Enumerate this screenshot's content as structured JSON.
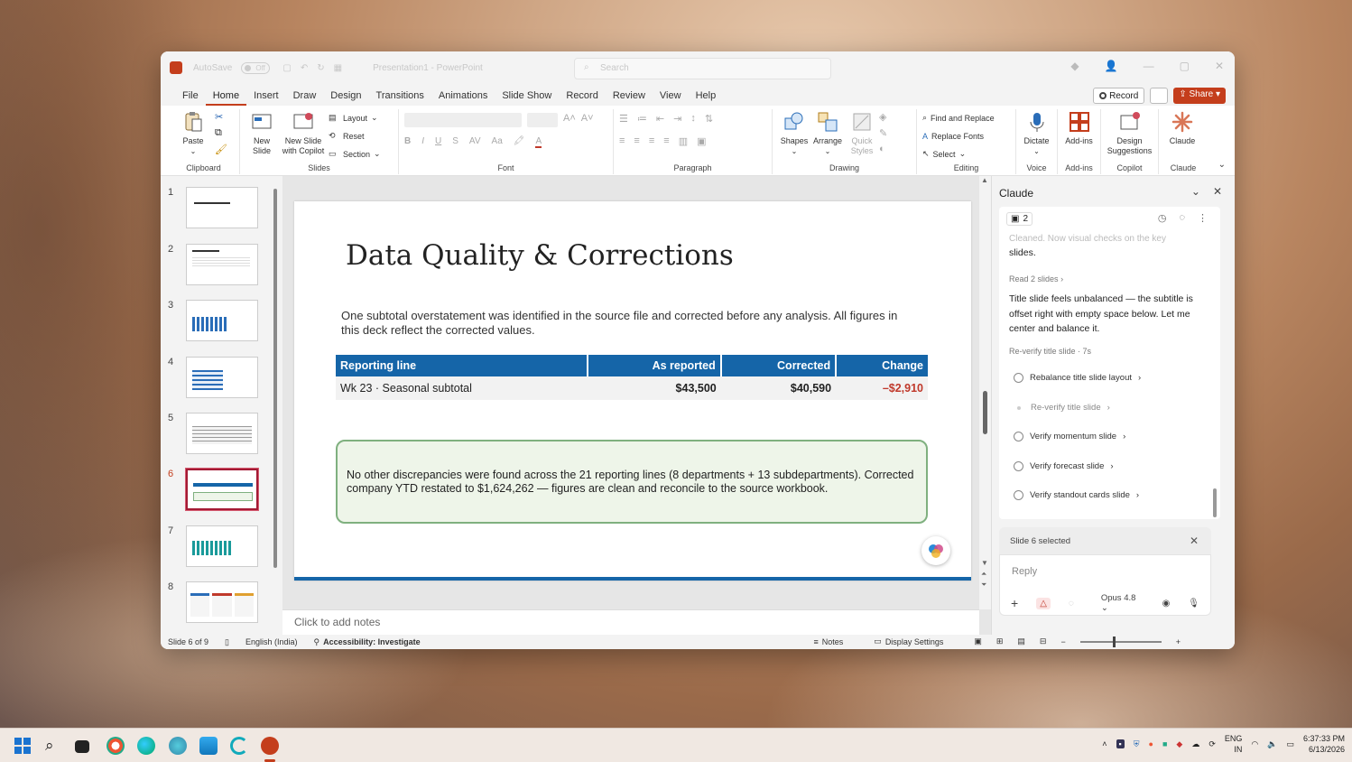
{
  "window": {
    "autosave_label": "AutoSave",
    "autosave_state": "Off",
    "doc_title": "Presentation1 - PowerPoint",
    "search_placeholder": "Search"
  },
  "menu": {
    "tabs": [
      "File",
      "Home",
      "Insert",
      "Draw",
      "Design",
      "Transitions",
      "Animations",
      "Slide Show",
      "Record",
      "Review",
      "View",
      "Help"
    ],
    "active": "Home",
    "record_label": "Record",
    "share_label": "Share"
  },
  "ribbon": {
    "clipboard": {
      "paste": "Paste",
      "label": "Clipboard"
    },
    "slides": {
      "new_slide": "New Slide",
      "new_slide_copilot": "New Slide with Copilot",
      "layout": "Layout",
      "reset": "Reset",
      "section": "Section",
      "label": "Slides"
    },
    "font": {
      "label": "Font"
    },
    "paragraph": {
      "label": "Paragraph"
    },
    "drawing": {
      "shapes": "Shapes",
      "arrange": "Arrange",
      "quick_styles": "Quick Styles",
      "label": "Drawing"
    },
    "editing": {
      "find_replace": "Find and Replace",
      "replace_fonts": "Replace Fonts",
      "select": "Select",
      "label": "Editing"
    },
    "voice": {
      "dictate": "Dictate",
      "label": "Voice"
    },
    "addins": {
      "addins": "Add-ins",
      "label": "Add-ins"
    },
    "copilot": {
      "design_suggestions": "Design Suggestions",
      "label": "Copilot"
    },
    "claude": {
      "claude": "Claude",
      "label": "Claude"
    }
  },
  "thumbnails": [
    {
      "num": "1"
    },
    {
      "num": "2"
    },
    {
      "num": "3"
    },
    {
      "num": "4"
    },
    {
      "num": "5"
    },
    {
      "num": "6"
    },
    {
      "num": "7"
    },
    {
      "num": "8"
    }
  ],
  "selected_slide": "6",
  "slide": {
    "title": "Data Quality & Corrections",
    "subtitle": "One subtotal overstatement was identified in the source file and corrected before any analysis. All figures in this deck reflect the corrected values.",
    "table": {
      "headers": [
        "Reporting line",
        "As reported",
        "Corrected",
        "Change"
      ],
      "rows": [
        [
          "Wk 23 · Seasonal subtotal",
          "$43,500",
          "$40,590",
          "–$2,910"
        ]
      ]
    },
    "callout": "No other discrepancies were found across the 21 reporting lines (8 departments + 13 subdepartments). Corrected company YTD restated to $1,624,262 — figures are clean and reconcile to the source workbook.",
    "notes_placeholder": "Click to add notes"
  },
  "claude_panel": {
    "title": "Claude",
    "chip_count": "2",
    "faded_line": "Cleaned. Now visual checks on the key",
    "line_slides": "slides.",
    "read_meta": "Read 2 slides",
    "message": "Title slide feels unbalanced — the subtitle is offset right with empty space below. Let me center and balance it.",
    "reverify_meta": "Re-verify title slide · 7s",
    "tasks": [
      {
        "label": "Rebalance title slide layout",
        "dim": false
      },
      {
        "label": "Re-verify title slide",
        "dim": true
      },
      {
        "label": "Verify momentum slide",
        "dim": false
      },
      {
        "label": "Verify forecast slide",
        "dim": false
      },
      {
        "label": "Verify standout cards slide",
        "dim": false
      }
    ],
    "selection_chip": "Slide 6 selected",
    "reply_placeholder": "Reply",
    "model": "Opus 4.8"
  },
  "statusbar": {
    "slide_info": "Slide 6 of 9",
    "language": "English (India)",
    "accessibility": "Accessibility: Investigate",
    "notes": "Notes",
    "display_settings": "Display Settings"
  },
  "taskbar": {
    "lang_top": "ENG",
    "lang_bottom": "IN",
    "time": "6:37:33 PM",
    "date": "6/13/2026"
  },
  "colors": {
    "accent": "#c43e1c",
    "table_header": "#1565a8",
    "negative": "#c0392b",
    "callout_border": "#7fb07f"
  }
}
